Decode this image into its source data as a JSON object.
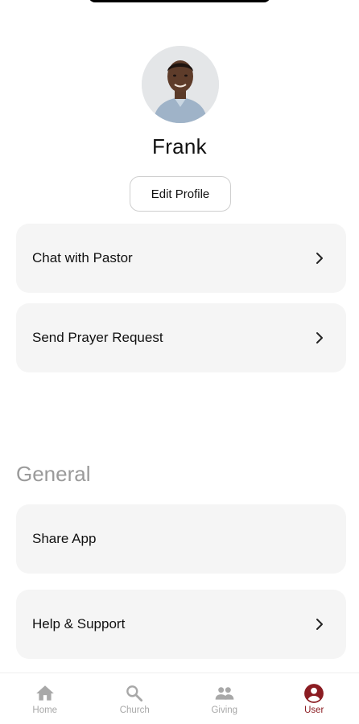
{
  "profile": {
    "name": "Frank",
    "edit_label": "Edit Profile"
  },
  "actions": [
    {
      "label": "Chat with Pastor",
      "has_chevron": true
    },
    {
      "label": "Send Prayer Request",
      "has_chevron": true
    }
  ],
  "general": {
    "title": "General",
    "items": [
      {
        "label": "Share App",
        "has_chevron": false
      },
      {
        "label": "Help & Support",
        "has_chevron": true
      }
    ]
  },
  "bottom_nav": {
    "active": "User",
    "items": [
      {
        "label": "Home",
        "icon": "home-icon"
      },
      {
        "label": "Church",
        "icon": "search-icon"
      },
      {
        "label": "Giving",
        "icon": "people-icon"
      },
      {
        "label": "User",
        "icon": "account-circle-icon"
      }
    ]
  },
  "colors": {
    "accent": "#8b1c22",
    "inactive": "#a8a8a8",
    "card_bg": "#f5f5f5",
    "section_title": "#9a9a9a"
  }
}
